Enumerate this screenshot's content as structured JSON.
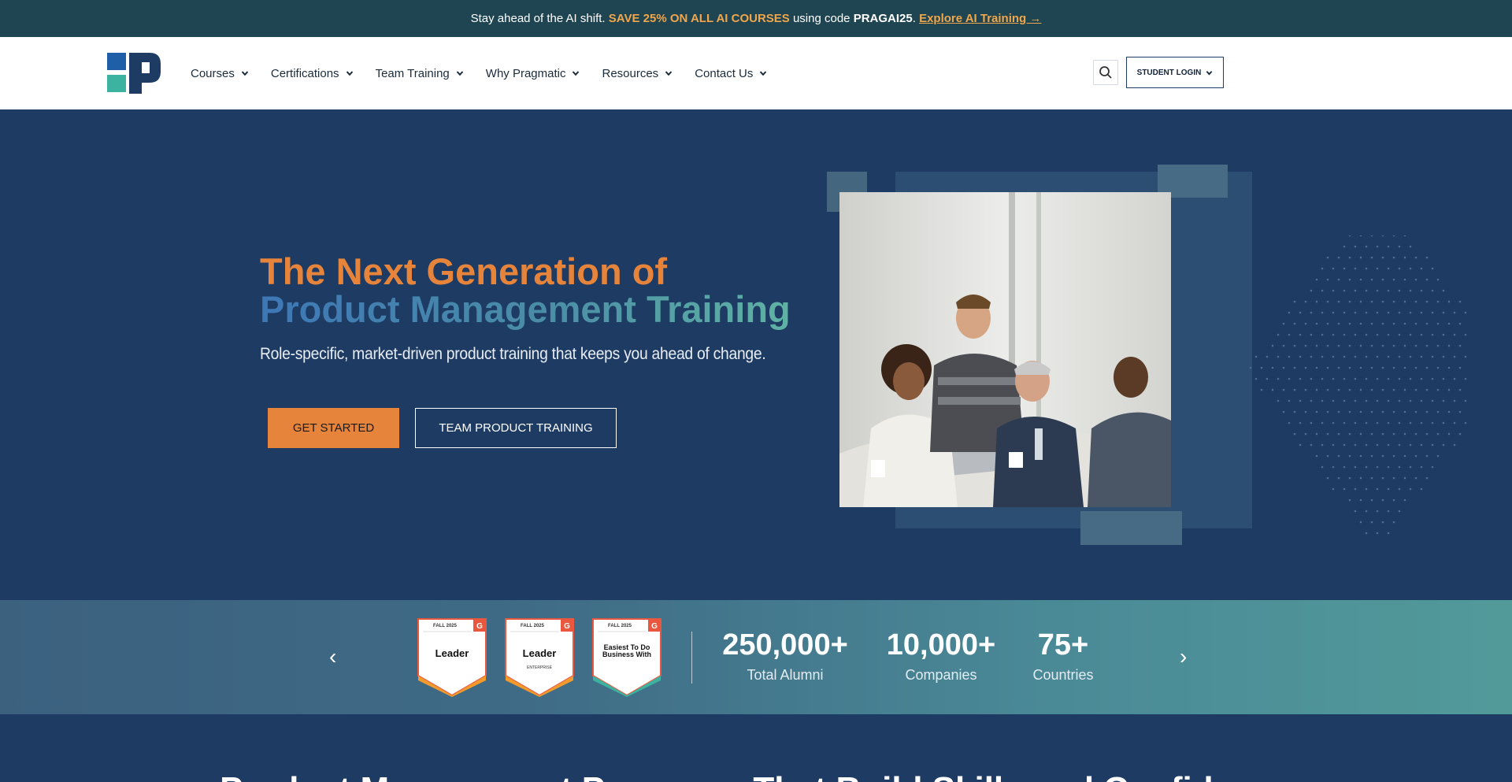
{
  "promo": {
    "text1": "Stay ahead of the AI shift. ",
    "highlight": "SAVE 25% ON ALL AI COURSES",
    "text2": " using code ",
    "code": "PRAGAI25",
    "text3": ". ",
    "link": "Explore AI Training →"
  },
  "nav": {
    "items": [
      {
        "label": "Courses"
      },
      {
        "label": "Certifications"
      },
      {
        "label": "Team Training"
      },
      {
        "label": "Why Pragmatic"
      },
      {
        "label": "Resources"
      },
      {
        "label": "Contact Us"
      }
    ],
    "login_label": "STUDENT LOGIN",
    "search_icon": "search-icon"
  },
  "hero": {
    "title_line1": "The Next Generation of",
    "title_line2": "Product Management Training",
    "subtitle": "Role-specific, market-driven product training that keeps you ahead of change.",
    "cta_primary": "GET STARTED",
    "cta_secondary": "TEAM PRODUCT TRAINING"
  },
  "badges": [
    {
      "season": "FALL 2025",
      "title": "Leader",
      "sub": ""
    },
    {
      "season": "FALL 2025",
      "title": "Leader",
      "sub": "ENTERPRISE"
    },
    {
      "season": "FALL 2025",
      "title": "Easiest To Do Business With",
      "sub": ""
    }
  ],
  "stats": [
    {
      "value": "250,000+",
      "label": "Total Alumni"
    },
    {
      "value": "10,000+",
      "label": "Companies"
    },
    {
      "value": "75+",
      "label": "Countries"
    }
  ],
  "carousel": {
    "prev": "‹",
    "next": "›"
  },
  "section": {
    "heading": "Product Management Programs That Build Skills and Confidence"
  },
  "colors": {
    "promo_bg": "#1f4552",
    "accent_orange": "#e6843b",
    "navy": "#1d3b63",
    "teal": "#529a9a"
  }
}
